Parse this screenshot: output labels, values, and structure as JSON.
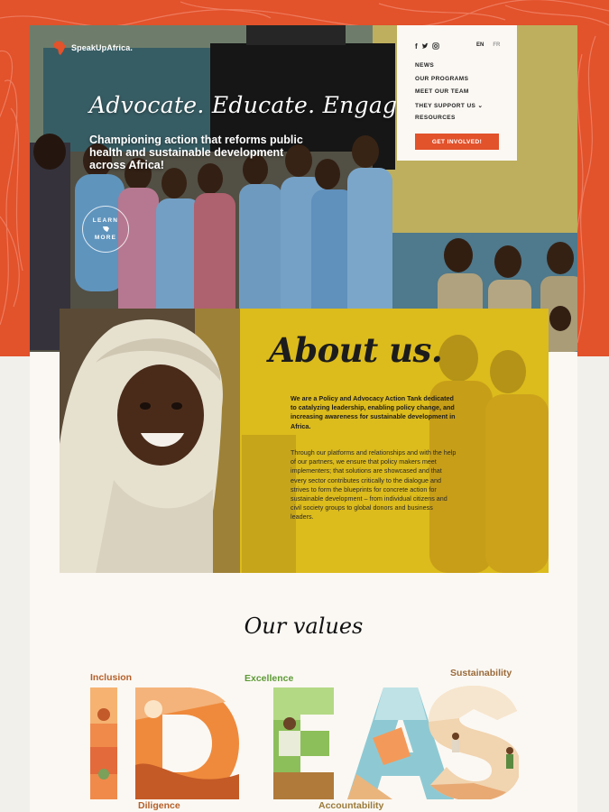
{
  "brand": {
    "name": "SpeakUpAfrica.",
    "accent": "#e2522b",
    "yellow": "#dcbb1c"
  },
  "nav": {
    "social_icons": [
      "facebook-icon",
      "twitter-icon",
      "instagram-icon"
    ],
    "languages": {
      "en": "EN",
      "fr": "FR"
    },
    "items": [
      {
        "label": "NEWS"
      },
      {
        "label": "OUR PROGRAMS"
      },
      {
        "label": "MEET OUR TEAM"
      },
      {
        "label": "THEY SUPPORT US ⌄"
      },
      {
        "label": "RESOURCES"
      }
    ],
    "cta": "GET INVOLVED!"
  },
  "hero": {
    "title": "Advocate. Educate. Engage.",
    "subtitle": "Championing action that reforms public health and sustainable development across Africa!",
    "learn_more_top": "LEARN",
    "learn_more_bottom": "MORE"
  },
  "about": {
    "title": "About us.",
    "lead": "We are a Policy and Advocacy Action Tank dedicated to catalyzing leadership, enabling policy change, and increasing awareness for sustainable development in Africa.",
    "body": "Through our platforms and relationships and with the help of our partners, we ensure that policy makers meet implementers; that solutions are showcased and that every sector contributes critically to the dialogue and strives to form the blueprints for concrete action for sustainable development – from individual citizens and civil society groups to global donors and business leaders."
  },
  "values": {
    "title": "Our values",
    "letters": "IDEAS",
    "labels": {
      "inclusion": "Inclusion",
      "diligence": "Diligence",
      "excellence": "Excellence",
      "accountability": "Accountability",
      "sustainability": "Sustainability"
    }
  }
}
